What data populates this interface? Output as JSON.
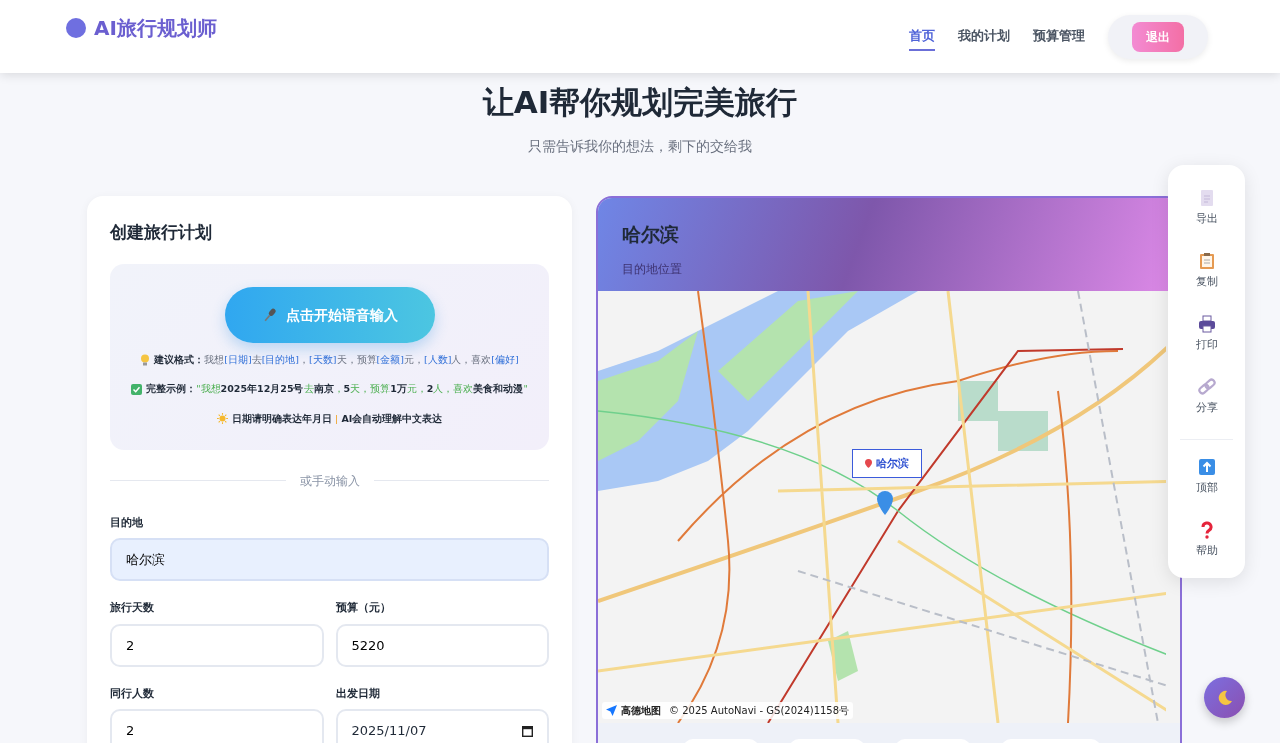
{
  "brand": {
    "title": "AI旅行规划师"
  },
  "nav": [
    {
      "label": "首页",
      "selected": true
    },
    {
      "label": "我的计划",
      "selected": false
    },
    {
      "label": "预算管理",
      "selected": false
    }
  ],
  "logout": "退出",
  "hero": {
    "title": "让AI帮你规划完美旅行",
    "subtitle": "只需告诉我你的想法，剩下的交给我"
  },
  "form": {
    "title": "创建旅行计划",
    "voice_button": "点击开始语音输入",
    "hints": [
      {
        "kind": "bulb",
        "label": "建议格式：",
        "parts": [
          {
            "text": "我想",
            "kind": "muted"
          },
          {
            "text": "[日期]",
            "kind": "slot"
          },
          {
            "text": "去",
            "kind": "muted"
          },
          {
            "text": "[目的地]",
            "kind": "slot"
          },
          {
            "text": "，",
            "kind": "muted"
          },
          {
            "text": "[天数]",
            "kind": "slot"
          },
          {
            "text": "天，预算",
            "kind": "muted"
          },
          {
            "text": "[金额]",
            "kind": "slot"
          },
          {
            "text": "元，",
            "kind": "muted"
          },
          {
            "text": "[人数]",
            "kind": "slot"
          },
          {
            "text": "人，喜欢",
            "kind": "muted"
          },
          {
            "text": "[偏好]",
            "kind": "slot"
          }
        ]
      },
      {
        "kind": "check",
        "label": "完整示例：",
        "parts": [
          {
            "text": "\"我想",
            "kind": "accent"
          },
          {
            "text": "2025年12月25号",
            "kind": "strong"
          },
          {
            "text": "去",
            "kind": "accent"
          },
          {
            "text": "南京",
            "kind": "strong"
          },
          {
            "text": "，",
            "kind": "accent"
          },
          {
            "text": "5",
            "kind": "strong"
          },
          {
            "text": "天，预算",
            "kind": "accent"
          },
          {
            "text": "1万",
            "kind": "strong"
          },
          {
            "text": "元，",
            "kind": "accent"
          },
          {
            "text": "2",
            "kind": "strong"
          },
          {
            "text": "人，喜欢",
            "kind": "accent"
          },
          {
            "text": "美食和动漫",
            "kind": "strong"
          },
          {
            "text": "\"",
            "kind": "accent"
          }
        ]
      },
      {
        "kind": "sun",
        "parts": [
          {
            "text": "日期请明确表达年月日 ",
            "kind": "strong"
          },
          {
            "text": "|",
            "kind": "sep"
          },
          {
            "text": " AI会自动理解中文表达",
            "kind": "strong"
          }
        ]
      }
    ],
    "divider": "或手动输入",
    "fields": [
      {
        "label": "目的地",
        "value": "哈尔滨",
        "kind": "text",
        "autofilled": true,
        "wide": true
      },
      {
        "label": "旅行天数",
        "value": "2",
        "kind": "text",
        "autofilled": false,
        "wide": false
      },
      {
        "label": "预算（元）",
        "value": "5220",
        "kind": "text",
        "autofilled": false,
        "wide": false
      },
      {
        "label": "同行人数",
        "value": "2",
        "kind": "text",
        "autofilled": false,
        "wide": false
      },
      {
        "label": "出发日期",
        "value": "2025/11/07",
        "kind": "date",
        "autofilled": false,
        "wide": false
      }
    ]
  },
  "map": {
    "title": "哈尔滨",
    "subtitle": "目的地位置",
    "marker_label": "哈尔滨",
    "provider": "高德地图",
    "attribution": "© 2025 AutoNavi - GS(2024)1158号"
  },
  "toolbar": [
    {
      "label": "导出",
      "kind": "doc"
    },
    {
      "label": "复制",
      "kind": "clipboard"
    },
    {
      "label": "打印",
      "kind": "printer"
    },
    {
      "label": "分享",
      "kind": "link"
    },
    {
      "label": "顶部",
      "kind": "up"
    },
    {
      "label": "帮助",
      "kind": "help"
    }
  ]
}
